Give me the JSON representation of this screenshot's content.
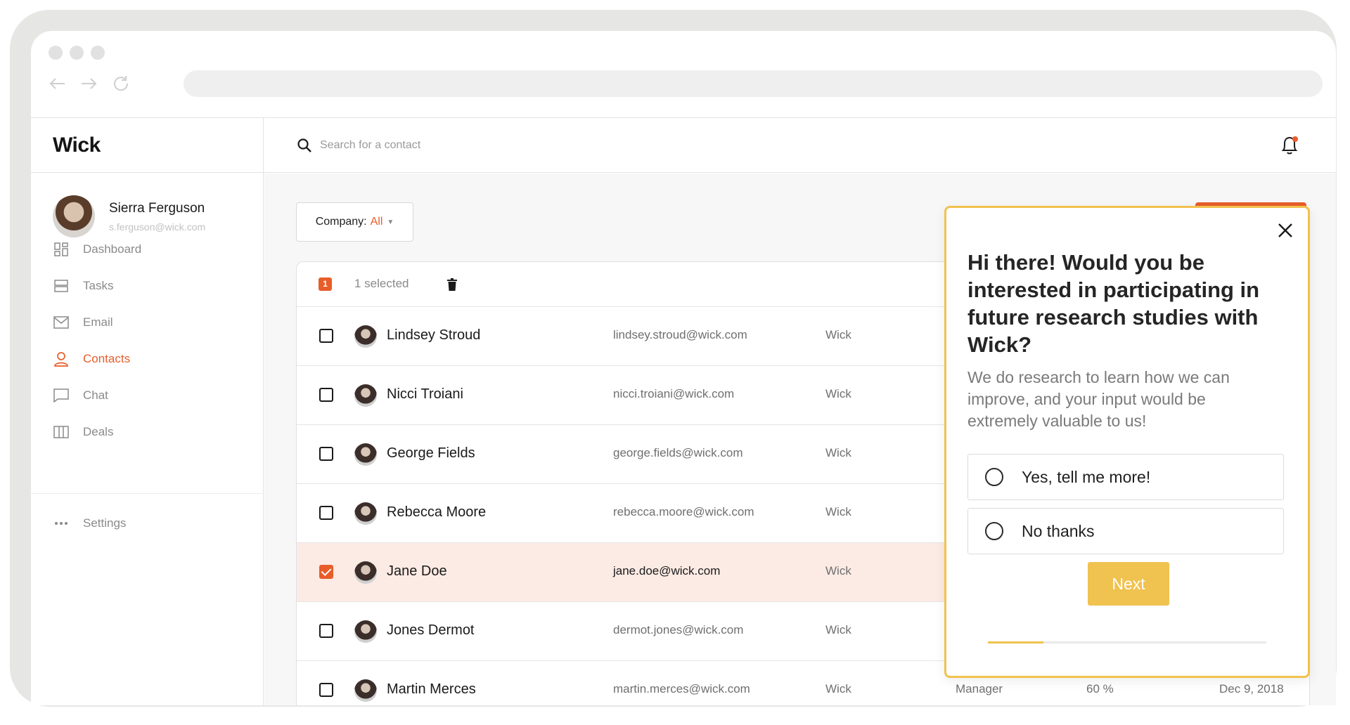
{
  "app": {
    "logo": "Wick"
  },
  "user": {
    "name": "Sierra Ferguson",
    "email": "s.ferguson@wick.com"
  },
  "menu": [
    {
      "label": "Dashboard",
      "icon": "dashboard-icon",
      "active": false
    },
    {
      "label": "Tasks",
      "icon": "tasks-icon",
      "active": false
    },
    {
      "label": "Email",
      "icon": "email-icon",
      "active": false
    },
    {
      "label": "Contacts",
      "icon": "contacts-icon",
      "active": true
    },
    {
      "label": "Chat",
      "icon": "chat-icon",
      "active": false
    },
    {
      "label": "Deals",
      "icon": "deals-icon",
      "active": false
    }
  ],
  "settings": {
    "label": "Settings",
    "icon": "more-icon"
  },
  "search": {
    "placeholder": "Search for a contact"
  },
  "filter": {
    "label": "Company:",
    "value": "All"
  },
  "selection": {
    "count": "1",
    "label": "1 selected"
  },
  "contacts": [
    {
      "name": "Lindsey Stroud",
      "email": "lindsey.stroud@wick.com",
      "company": "Wick",
      "selected": false
    },
    {
      "name": "Nicci Troiani",
      "email": "nicci.troiani@wick.com",
      "company": "Wick",
      "selected": false
    },
    {
      "name": "George Fields",
      "email": "george.fields@wick.com",
      "company": "Wick",
      "selected": false
    },
    {
      "name": "Rebecca Moore",
      "email": "rebecca.moore@wick.com",
      "company": "Wick",
      "selected": false
    },
    {
      "name": "Jane Doe",
      "email": "jane.doe@wick.com",
      "company": "Wick",
      "selected": true
    },
    {
      "name": "Jones Dermot",
      "email": "dermot.jones@wick.com",
      "company": "Wick",
      "selected": false
    },
    {
      "name": "Martin Merces",
      "email": "martin.merces@wick.com",
      "company": "Wick",
      "role": "Manager",
      "forecast": "60 %",
      "date": "Dec 9, 2018",
      "selected": false
    }
  ],
  "survey": {
    "title": "Hi there! Would you be interested in participating in future research studies with Wick?",
    "body": "We do research to learn how we can improve, and your input would be extremely valuable to us!",
    "options": [
      "Yes, tell me more!",
      "No thanks"
    ],
    "next_label": "Next",
    "progress": 0.2
  },
  "colors": {
    "accent": "#e85d2a",
    "survey_accent": "#f0c24f",
    "selected_row": "#fcebe4"
  }
}
